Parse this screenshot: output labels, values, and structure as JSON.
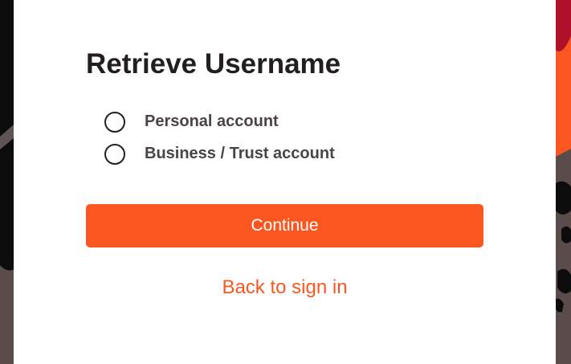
{
  "page": {
    "title": "Retrieve Username"
  },
  "account_type": {
    "options": [
      {
        "label": "Personal account",
        "selected": false
      },
      {
        "label": "Business / Trust account",
        "selected": false
      }
    ]
  },
  "actions": {
    "continue_label": "Continue",
    "back_label": "Back to sign in"
  },
  "colors": {
    "accent": "#fc5620",
    "title_text": "#231f20",
    "option_text": "#4a4446",
    "background_dark": "#0c0c0c",
    "background_right": "#5a4c4b",
    "decor_red": "#b0102a",
    "decor_orange": "#fc5620"
  }
}
